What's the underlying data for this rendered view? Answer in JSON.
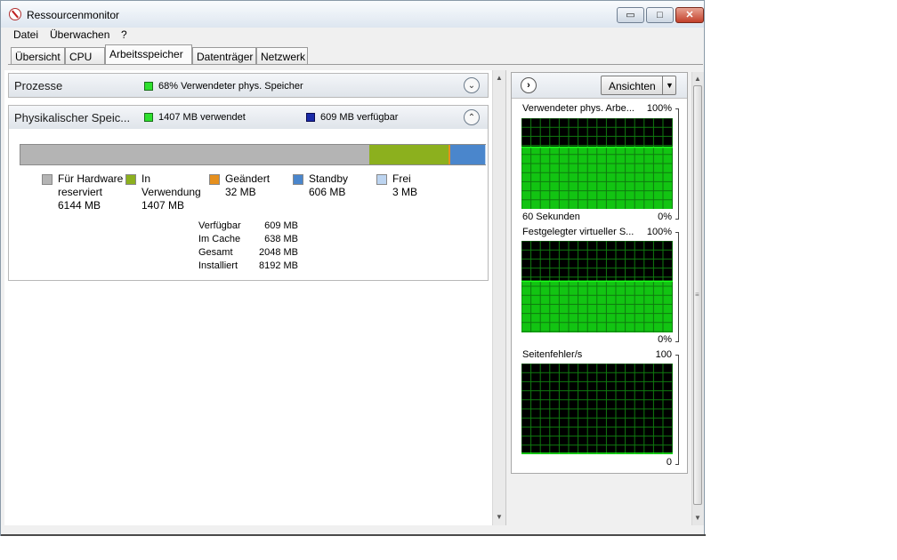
{
  "window": {
    "title": "Ressourcenmonitor",
    "minimize_glyph": "▭",
    "maximize_glyph": "□",
    "close_glyph": "✕"
  },
  "menu": {
    "items": [
      {
        "label": "Datei"
      },
      {
        "label": "Überwachen"
      },
      {
        "label": "?"
      }
    ]
  },
  "tabs": [
    {
      "label": "Übersicht",
      "active": false
    },
    {
      "label": "CPU",
      "active": false
    },
    {
      "label": "Arbeitsspeicher",
      "active": true
    },
    {
      "label": "Datenträger",
      "active": false
    },
    {
      "label": "Netzwerk",
      "active": false
    }
  ],
  "processes_section": {
    "title": "Prozesse",
    "indicator_text": "68% Verwendeter phys. Speicher",
    "collapse_icon": "chevron-down-icon"
  },
  "physical_section": {
    "title": "Physikalischer Speic...",
    "used_text": "1407 MB verwendet",
    "available_text": "609 MB verfügbar",
    "collapse_icon": "chevron-up-icon"
  },
  "memory_bar": {
    "unit": "MB",
    "segments": [
      {
        "name": "Für Hardware reserviert",
        "mb": 6144,
        "color": "#b4b4b4"
      },
      {
        "name": "In Verwendung",
        "mb": 1407,
        "color": "#8cb01e"
      },
      {
        "name": "Geändert",
        "mb": 32,
        "color": "#e6901e"
      },
      {
        "name": "Standby",
        "mb": 606,
        "color": "#4a86cc"
      },
      {
        "name": "Frei",
        "mb": 3,
        "color": "#bcd4f0"
      }
    ]
  },
  "legend": [
    {
      "line1": "Für Hardware",
      "line2": "reserviert",
      "line3": "6144 MB",
      "color": "#b4b4b4"
    },
    {
      "line1": "In",
      "line2": "Verwendung",
      "line3": "1407 MB",
      "color": "#8cb01e"
    },
    {
      "line1": "Geändert",
      "line2": "32 MB",
      "line3": "",
      "color": "#e6901e"
    },
    {
      "line1": "Standby",
      "line2": "606 MB",
      "line3": "",
      "color": "#4a86cc"
    },
    {
      "line1": "Frei",
      "line2": "3 MB",
      "line3": "",
      "color": "#bcd4f0"
    }
  ],
  "stats": [
    {
      "label": "Verfügbar",
      "value": "609 MB"
    },
    {
      "label": "Im Cache",
      "value": "638 MB"
    },
    {
      "label": "Gesamt",
      "value": "2048 MB"
    },
    {
      "label": "Installiert",
      "value": "8192 MB"
    }
  ],
  "right_pane": {
    "expand_icon": "chevron-right-icon",
    "views_button": "Ansichten",
    "graphs": [
      {
        "title": "Verwendeter phys. Arbe...",
        "max_label": "100%",
        "min_label": "0%",
        "footer": "60 Sekunden",
        "level_percent": 68
      },
      {
        "title": "Festgelegter virtueller S...",
        "max_label": "100%",
        "min_label": "0%",
        "footer": "",
        "level_percent": 56
      },
      {
        "title": "Seitenfehler/s",
        "max_label": "100",
        "min_label": "0",
        "footer": "",
        "level_percent": 1
      }
    ]
  },
  "colors": {
    "graph_bg": "#000000",
    "graph_grid": "#0f7a0f",
    "graph_fill": "#12c412",
    "graph_line": "#1aff1a"
  }
}
